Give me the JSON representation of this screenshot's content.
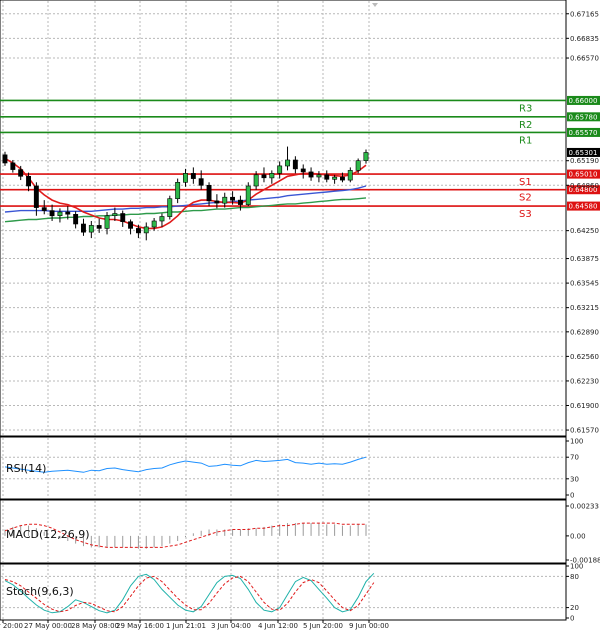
{
  "chart_data": [
    {
      "type": "candlestick",
      "price_axis": {
        "ticks": [
          "0.67165",
          "0.66835",
          "0.66570",
          "0.65190",
          "0.64860",
          "0.64250",
          "0.63875",
          "0.63545",
          "0.63215",
          "0.62890",
          "0.62560",
          "0.62230",
          "0.61900",
          "0.61570"
        ],
        "tick_values": [
          0.67165,
          0.66835,
          0.6657,
          0.6519,
          0.6486,
          0.6425,
          0.63875,
          0.63545,
          0.63215,
          0.6289,
          0.6256,
          0.6223,
          0.619,
          0.6157
        ],
        "ylim": [
          0.6149,
          0.6735
        ]
      },
      "time_labels": [
        "y 20:00",
        "27 May 00:00",
        "28 May 08:00",
        "29 May 16:00",
        "1 Jun 21:01",
        "3 Jun 04:00",
        "4 Jun 12:00",
        "5 Jun 20:00",
        "9 Jun 00:00"
      ],
      "current_price": "0.65301",
      "levels": [
        {
          "label": "R3",
          "value": 0.66,
          "text": "0.66000",
          "color": "#1a8a1a"
        },
        {
          "label": "R2",
          "value": 0.6578,
          "text": "0.65780",
          "color": "#1a8a1a"
        },
        {
          "label": "R1",
          "value": 0.6557,
          "text": "0.65570",
          "color": "#1a8a1a"
        },
        {
          "label": "S1",
          "value": 0.6501,
          "text": "0.65010",
          "color": "#dd1111"
        },
        {
          "label": "S2",
          "value": 0.648,
          "text": "0.64800",
          "color": "#dd1111"
        },
        {
          "label": "S3",
          "value": 0.6458,
          "text": "0.64580",
          "color": "#dd1111"
        }
      ],
      "candles": [
        [
          0.6527,
          0.6531,
          0.6512,
          0.6516
        ],
        [
          0.6516,
          0.652,
          0.6503,
          0.6507
        ],
        [
          0.6507,
          0.6512,
          0.6493,
          0.6498
        ],
        [
          0.6498,
          0.6503,
          0.6478,
          0.6485
        ],
        [
          0.6485,
          0.649,
          0.6445,
          0.6456
        ],
        [
          0.6456,
          0.6466,
          0.6447,
          0.6452
        ],
        [
          0.6452,
          0.646,
          0.6438,
          0.6445
        ],
        [
          0.6445,
          0.6455,
          0.6436,
          0.645
        ],
        [
          0.645,
          0.6458,
          0.644,
          0.6447
        ],
        [
          0.6447,
          0.6451,
          0.6428,
          0.6434
        ],
        [
          0.6434,
          0.6441,
          0.6418,
          0.6423
        ],
        [
          0.6423,
          0.6438,
          0.6415,
          0.6432
        ],
        [
          0.6432,
          0.6441,
          0.6422,
          0.6428
        ],
        [
          0.6428,
          0.645,
          0.642,
          0.6445
        ],
        [
          0.6445,
          0.6456,
          0.6438,
          0.6448
        ],
        [
          0.6448,
          0.6452,
          0.643,
          0.6437
        ],
        [
          0.6437,
          0.644,
          0.642,
          0.6428
        ],
        [
          0.6428,
          0.6433,
          0.6415,
          0.6422
        ],
        [
          0.6422,
          0.6436,
          0.6412,
          0.643
        ],
        [
          0.643,
          0.6442,
          0.6425,
          0.6438
        ],
        [
          0.6438,
          0.6448,
          0.643,
          0.6444
        ],
        [
          0.6444,
          0.6472,
          0.644,
          0.6468
        ],
        [
          0.6468,
          0.6495,
          0.6462,
          0.649
        ],
        [
          0.649,
          0.6508,
          0.6484,
          0.6502
        ],
        [
          0.6502,
          0.651,
          0.6488,
          0.6495
        ],
        [
          0.6495,
          0.6506,
          0.648,
          0.6486
        ],
        [
          0.6486,
          0.649,
          0.6458,
          0.6465
        ],
        [
          0.6465,
          0.6474,
          0.6455,
          0.6462
        ],
        [
          0.6462,
          0.6476,
          0.6456,
          0.647
        ],
        [
          0.647,
          0.6478,
          0.646,
          0.6466
        ],
        [
          0.6466,
          0.6472,
          0.6452,
          0.646
        ],
        [
          0.646,
          0.649,
          0.6458,
          0.6485
        ],
        [
          0.6485,
          0.6505,
          0.648,
          0.65
        ],
        [
          0.65,
          0.651,
          0.649,
          0.6496
        ],
        [
          0.6496,
          0.6506,
          0.6488,
          0.6502
        ],
        [
          0.6502,
          0.6518,
          0.6495,
          0.6512
        ],
        [
          0.6512,
          0.6538,
          0.6506,
          0.652
        ],
        [
          0.652,
          0.6525,
          0.6502,
          0.6508
        ],
        [
          0.6508,
          0.6514,
          0.6495,
          0.6504
        ],
        [
          0.6504,
          0.651,
          0.6492,
          0.6497
        ],
        [
          0.6497,
          0.6505,
          0.649,
          0.65
        ],
        [
          0.65,
          0.6506,
          0.649,
          0.6494
        ],
        [
          0.6494,
          0.65,
          0.6488,
          0.6497
        ],
        [
          0.6497,
          0.6503,
          0.649,
          0.6493
        ],
        [
          0.6493,
          0.651,
          0.649,
          0.6506
        ],
        [
          0.6506,
          0.6522,
          0.6502,
          0.6519
        ],
        [
          0.6519,
          0.6534,
          0.6515,
          0.653
        ]
      ],
      "ma_fast": [
        0.6522,
        0.6516,
        0.6508,
        0.6496,
        0.6482,
        0.6473,
        0.6466,
        0.6462,
        0.646,
        0.6456,
        0.645,
        0.6446,
        0.6442,
        0.644,
        0.644,
        0.6438,
        0.6434,
        0.643,
        0.6428,
        0.6428,
        0.643,
        0.6436,
        0.6445,
        0.6456,
        0.6463,
        0.6466,
        0.6466,
        0.6464,
        0.6463,
        0.6463,
        0.6462,
        0.6466,
        0.6474,
        0.648,
        0.6486,
        0.6492,
        0.6498,
        0.65,
        0.6502,
        0.6502,
        0.6501,
        0.65,
        0.6499,
        0.6498,
        0.65,
        0.6505,
        0.6513
      ],
      "ma_mid": [
        0.645,
        0.6451,
        0.6452,
        0.6452,
        0.6452,
        0.6452,
        0.6451,
        0.6451,
        0.6451,
        0.6451,
        0.6451,
        0.6451,
        0.6452,
        0.6453,
        0.6454,
        0.6454,
        0.6455,
        0.6455,
        0.6456,
        0.6456,
        0.6457,
        0.6457,
        0.6458,
        0.6459,
        0.646,
        0.6461,
        0.6462,
        0.6463,
        0.6463,
        0.6464,
        0.6465,
        0.6466,
        0.6467,
        0.6468,
        0.6469,
        0.647,
        0.6472,
        0.6473,
        0.6474,
        0.6475,
        0.6476,
        0.6477,
        0.6478,
        0.6479,
        0.648,
        0.6482,
        0.6485
      ],
      "ma_slow": [
        0.6437,
        0.6438,
        0.6439,
        0.644,
        0.644,
        0.6441,
        0.6442,
        0.6442,
        0.6443,
        0.6443,
        0.6444,
        0.6444,
        0.6445,
        0.6445,
        0.6446,
        0.6446,
        0.6447,
        0.6447,
        0.6448,
        0.6448,
        0.6449,
        0.645,
        0.645,
        0.6451,
        0.6452,
        0.6452,
        0.6453,
        0.6454,
        0.6454,
        0.6455,
        0.6456,
        0.6456,
        0.6457,
        0.6458,
        0.6459,
        0.646,
        0.6461,
        0.6461,
        0.6462,
        0.6463,
        0.6464,
        0.6465,
        0.6466,
        0.6467,
        0.6467,
        0.6468,
        0.6469
      ]
    },
    {
      "type": "line",
      "label": "RSI(14)",
      "ylim": [
        0,
        100
      ],
      "ticks": [
        "100",
        "70",
        "30",
        "0"
      ],
      "tick_values": [
        100,
        70,
        30,
        0
      ],
      "values": [
        52,
        50,
        48,
        46,
        44,
        42,
        44,
        45,
        46,
        44,
        42,
        46,
        45,
        49,
        50,
        47,
        45,
        43,
        47,
        49,
        50,
        56,
        60,
        63,
        61,
        59,
        53,
        54,
        57,
        55,
        54,
        60,
        64,
        62,
        63,
        64,
        66,
        60,
        59,
        57,
        59,
        57,
        58,
        57,
        61,
        66,
        70
      ]
    },
    {
      "type": "bar",
      "label": "MACD(12,26,9)",
      "ylim": [
        -0.00188,
        0.00233
      ],
      "ticks": [
        "0.00233",
        "0.00",
        "-0.00188"
      ],
      "tick_values": [
        0.00233,
        0,
        -0.00188
      ],
      "histogram": [
        0.0005,
        0.0007,
        0.0008,
        0.0008,
        0.0006,
        0.0003,
        0.0,
        -0.0002,
        -0.0004,
        -0.0006,
        -0.0008,
        -0.0009,
        -0.0009,
        -0.0009,
        -0.0009,
        -0.0009,
        -0.0009,
        -0.001,
        -0.001,
        -0.0009,
        -0.0008,
        -0.0006,
        -0.0004,
        -0.0001,
        0.0002,
        0.0004,
        0.0005,
        0.0005,
        0.0005,
        0.0005,
        0.0005,
        0.0006,
        0.0006,
        0.0007,
        0.0008,
        0.0009,
        0.001,
        0.001,
        0.001,
        0.001,
        0.001,
        0.0009,
        0.0009,
        0.0008,
        0.0008,
        0.0009,
        0.0009
      ],
      "signal": [
        0.0004,
        0.0006,
        0.0008,
        0.0009,
        0.0009,
        0.0008,
        0.0006,
        0.0003,
        0.0,
        -0.0003,
        -0.0005,
        -0.0007,
        -0.0008,
        -0.0009,
        -0.0009,
        -0.0009,
        -0.0009,
        -0.0009,
        -0.0009,
        -0.0009,
        -0.0009,
        -0.0008,
        -0.0007,
        -0.0005,
        -0.0003,
        -0.0001,
        0.0001,
        0.0003,
        0.0004,
        0.0005,
        0.0005,
        0.0005,
        0.0006,
        0.0006,
        0.0007,
        0.0008,
        0.0008,
        0.0009,
        0.001,
        0.001,
        0.001,
        0.001,
        0.001,
        0.0009,
        0.0009,
        0.0009,
        0.0009
      ]
    },
    {
      "type": "line",
      "label": "Stoch(9,6,3)",
      "ylim": [
        0,
        100
      ],
      "ticks": [
        "100",
        "80",
        "20",
        "0"
      ],
      "tick_values": [
        100,
        80,
        20,
        0
      ],
      "main": [
        72,
        64,
        52,
        38,
        25,
        15,
        10,
        12,
        22,
        35,
        30,
        22,
        14,
        10,
        15,
        35,
        62,
        80,
        84,
        74,
        55,
        40,
        25,
        15,
        12,
        22,
        45,
        68,
        80,
        82,
        76,
        55,
        30,
        15,
        12,
        20,
        45,
        70,
        78,
        72,
        55,
        38,
        20,
        12,
        16,
        40,
        70,
        86
      ],
      "signal": [
        74,
        70,
        62,
        50,
        38,
        26,
        17,
        12,
        15,
        24,
        30,
        28,
        21,
        14,
        12,
        22,
        42,
        62,
        77,
        80,
        70,
        54,
        38,
        25,
        16,
        16,
        28,
        48,
        66,
        77,
        80,
        70,
        50,
        30,
        17,
        15,
        28,
        50,
        68,
        74,
        68,
        52,
        35,
        20,
        14,
        24,
        46,
        68
      ]
    }
  ]
}
